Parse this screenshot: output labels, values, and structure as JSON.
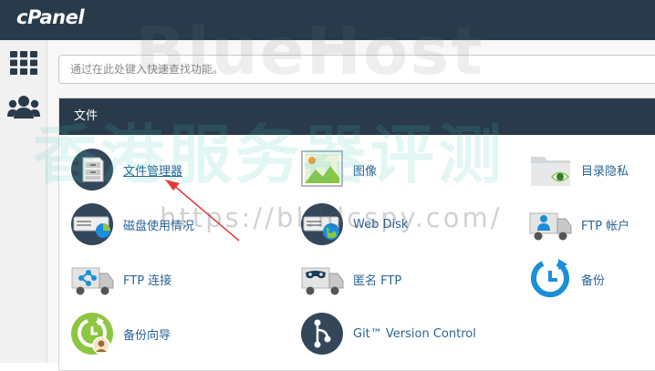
{
  "header": {
    "logo": "cPanel"
  },
  "sidebar": {
    "items": [
      {
        "icon": "grid-icon"
      },
      {
        "icon": "users-icon"
      }
    ]
  },
  "search": {
    "placeholder": "通过在此处键入快速查找功能。"
  },
  "panel": {
    "title": "文件",
    "items": [
      {
        "label": "文件管理器",
        "icon": "file-manager-icon"
      },
      {
        "label": "图像",
        "icon": "images-icon"
      },
      {
        "label": "目录隐私",
        "icon": "directory-privacy-icon"
      },
      {
        "label": "磁盘使用情况",
        "icon": "disk-usage-icon"
      },
      {
        "label": "Web Disk",
        "icon": "web-disk-icon"
      },
      {
        "label": "FTP 帐户",
        "icon": "ftp-accounts-icon"
      },
      {
        "label": "FTP 连接",
        "icon": "ftp-connections-icon"
      },
      {
        "label": "匿名 FTP",
        "icon": "anonymous-ftp-icon"
      },
      {
        "label": "备份",
        "icon": "backup-icon"
      },
      {
        "label": "备份向导",
        "icon": "backup-wizard-icon"
      },
      {
        "label": "Git™ Version Control",
        "icon": "git-icon"
      }
    ]
  },
  "watermark": {
    "brand": "BlueHost",
    "site_name": "香港服务器评测",
    "url": "https://bl.idcspy.com/"
  },
  "colors": {
    "header_bg": "#293a4a",
    "link": "#2a6496",
    "icon_navy": "#33465a",
    "icon_blue": "#1a8fd9",
    "icon_green": "#8dc63f"
  }
}
